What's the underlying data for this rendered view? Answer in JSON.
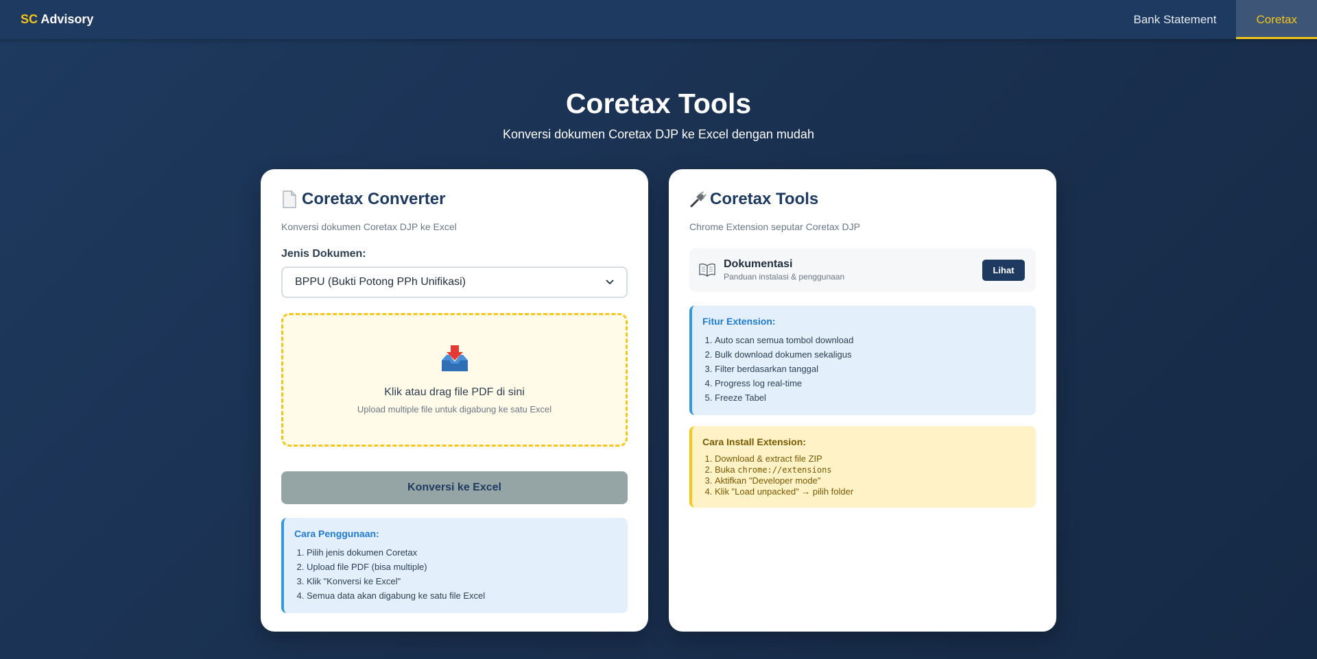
{
  "nav": {
    "brand_accent": "SC",
    "brand_rest": " Advisory",
    "links": [
      {
        "label": "Bank Statement",
        "active": false
      },
      {
        "label": "Coretax",
        "active": true
      }
    ]
  },
  "hero": {
    "title": "Coretax Tools",
    "subtitle": "Konversi dokumen Coretax DJP ke Excel dengan mudah"
  },
  "converter": {
    "icon": "document-icon",
    "title": "Coretax Converter",
    "subtitle": "Konversi dokumen Coretax DJP ke Excel",
    "doc_type_label": "Jenis Dokumen:",
    "doc_type_selected": "BPPU (Bukti Potong PPh Unifikasi)",
    "dropzone_icon": "inbox-tray-icon",
    "dropzone_main": "Klik atau drag file PDF di sini",
    "dropzone_sub": "Upload multiple file untuk digabung ke satu Excel",
    "convert_button": "Konversi ke Excel",
    "usage_title": "Cara Penggunaan:",
    "usage_steps": [
      "Pilih jenis dokumen Coretax",
      "Upload file PDF (bisa multiple)",
      "Klik \"Konversi ke Excel\"",
      "Semua data akan digabung ke satu file Excel"
    ]
  },
  "tools": {
    "icon": "plug-icon",
    "title": "Coretax Tools",
    "subtitle": "Chrome Extension seputar Coretax DJP",
    "doc_icon": "open-book-icon",
    "doc_title": "Dokumentasi",
    "doc_sub": "Panduan instalasi & penggunaan",
    "view_button": "Lihat",
    "features_title": "Fitur Extension:",
    "features": [
      "Auto scan semua tombol download",
      "Bulk download dokumen sekaligus",
      "Filter berdasarkan tanggal",
      "Progress log real-time",
      "Freeze Tabel"
    ],
    "install_title": "Cara Install Extension:",
    "install_steps": {
      "s1": "Download & extract file ZIP",
      "s2_prefix": "Buka ",
      "s2_code": "chrome://extensions",
      "s3": "Aktifkan \"Developer mode\"",
      "s4": "Klik \"Load unpacked\" → pilih folder"
    }
  },
  "colors": {
    "accent": "#f5c518",
    "navy": "#1f3a60",
    "info_blue": "#3498db",
    "disabled_button": "#95a5a6"
  }
}
